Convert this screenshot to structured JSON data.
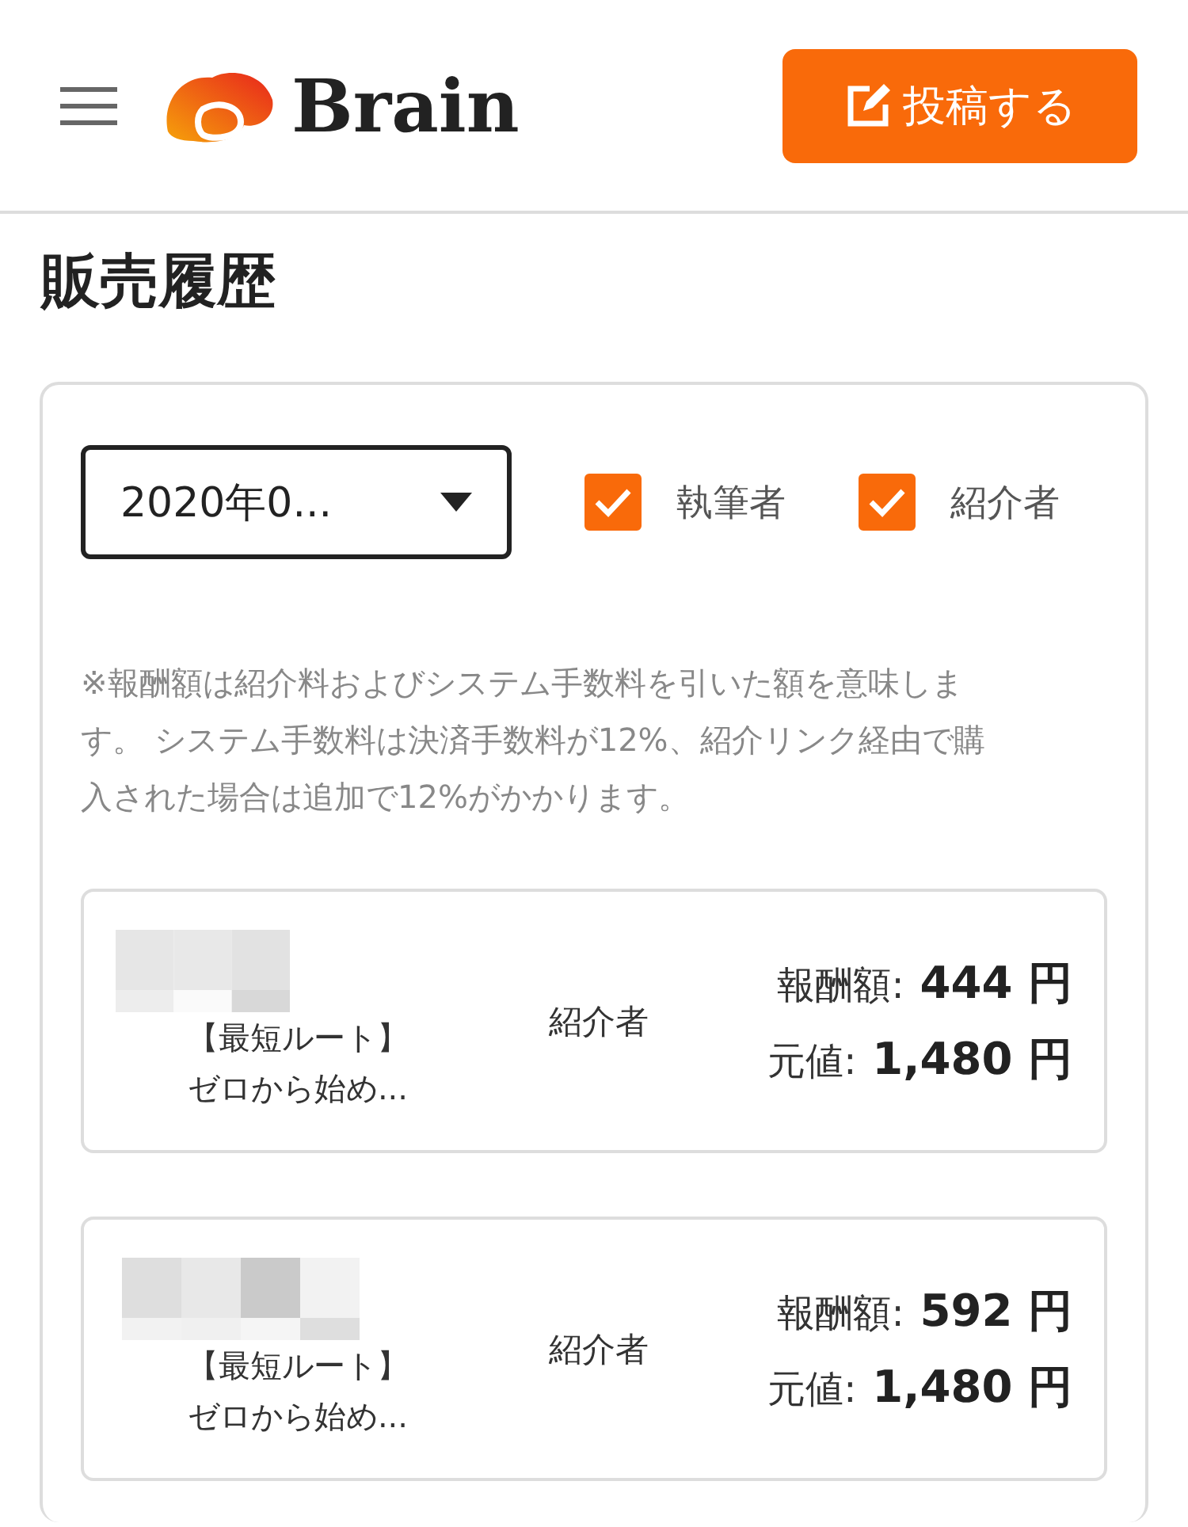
{
  "header": {
    "logo_text": "Brain",
    "post_button": "投稿する"
  },
  "page_title": "販売履歴",
  "filters": {
    "month_select": "2020年0...",
    "checkboxes": [
      {
        "label": "執筆者",
        "checked": true
      },
      {
        "label": "紹介者",
        "checked": true
      }
    ]
  },
  "note": "※報酬額は紹介料およびシステム手数料を引いた額を意味します。 システム手数料は決済手数料が12%、紹介リンク経由で購入された場合は追加で12%がかかります。",
  "sales": [
    {
      "title_lines": [
        "【最短ルート】",
        "ゼロから始め..."
      ],
      "role": "紹介者",
      "reward_label": "報酬額:",
      "reward": "444 円",
      "price_label": "元値:",
      "price": "1,480 円"
    },
    {
      "title_lines": [
        "【最短ルート】",
        "ゼロから始め..."
      ],
      "role": "紹介者",
      "reward_label": "報酬額:",
      "reward": "592 円",
      "price_label": "元値:",
      "price": "1,480 円"
    }
  ]
}
